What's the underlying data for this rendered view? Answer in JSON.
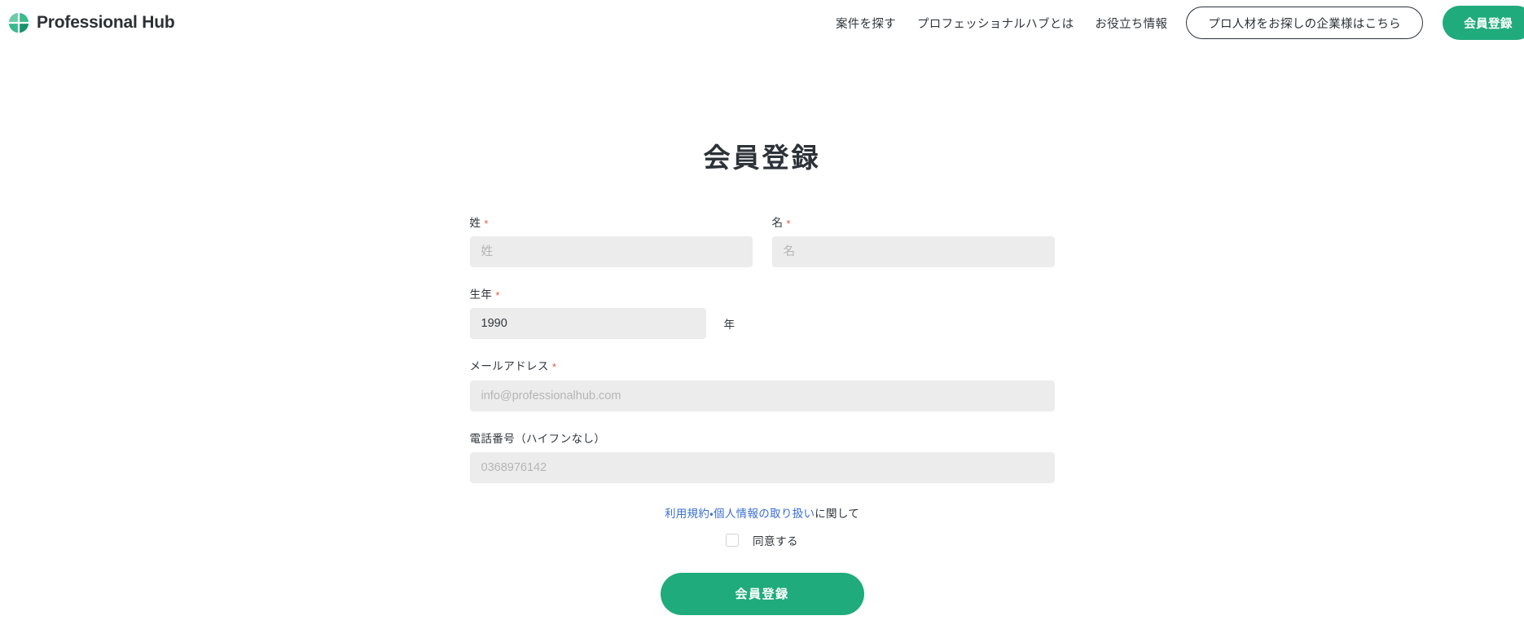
{
  "brand": {
    "name": "Professional Hub",
    "logo_colors": {
      "light": "#7fd0ad",
      "mid": "#4cc095",
      "dark": "#22a97c",
      "deep": "#17936b"
    }
  },
  "nav": {
    "links": [
      {
        "label": "案件を探す"
      },
      {
        "label": "プロフェッショナルハブとは"
      },
      {
        "label": "お役立ち情報"
      }
    ],
    "outline_button": "プロ人材をお探しの企業様はこちら",
    "register_button": "会員登録"
  },
  "page": {
    "title": "会員登録"
  },
  "form": {
    "last_name": {
      "label": "姓",
      "required_mark": "*",
      "placeholder": "姓",
      "value": ""
    },
    "first_name": {
      "label": "名",
      "required_mark": "*",
      "placeholder": "名",
      "value": ""
    },
    "birth_year": {
      "label": "生年",
      "required_mark": "*",
      "value": "1990",
      "suffix": "年"
    },
    "email": {
      "label": "メールアドレス",
      "required_mark": "*",
      "placeholder": "info@professionalhub.com",
      "value": ""
    },
    "phone": {
      "label": "電話番号（ハイフンなし）",
      "placeholder": "0368976142",
      "value": ""
    }
  },
  "terms": {
    "link_text": "利用規約・個人情報の取り扱い",
    "suffix_text": "に関して",
    "agree_label": "同意する",
    "checked": false
  },
  "submit": {
    "label": "会員登録"
  },
  "colors": {
    "brand_green": "#20ab7d",
    "link_blue": "#3b6fd4",
    "required_red": "#e8593c",
    "input_bg": "#ececec",
    "text_dark": "#2c3238"
  }
}
